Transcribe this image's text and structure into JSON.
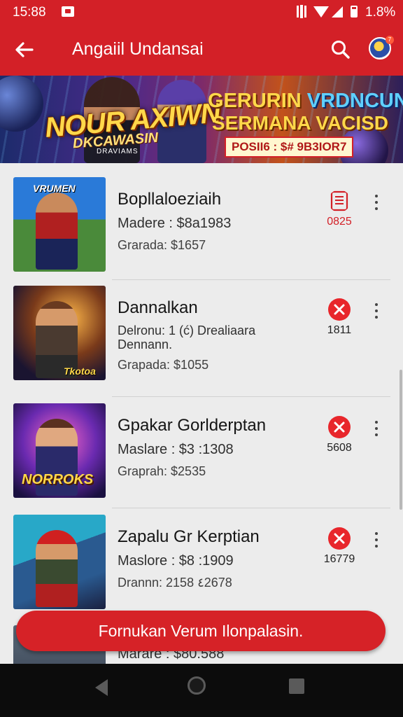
{
  "status_bar": {
    "time": "15:88",
    "battery": "1.8%"
  },
  "app_bar": {
    "title": "Angaiil Undansai",
    "avatar_badge": "7"
  },
  "banner": {
    "title": "NOUR AXIWN",
    "subtitle": "DKCAWASIN",
    "subtitle2": "DRAVIAMS",
    "headline1_a": "GERURIN",
    "headline1_b": "VRDNCUN",
    "headline2": "SERMANA VACISD",
    "promo_code": "POSII6 : $# 9B3IOR7"
  },
  "items": [
    {
      "name": "Bopllaloeziaih",
      "line2": "Madere : $8a1983",
      "line3": "Grarada: $1657",
      "action": "doc",
      "count": "0825",
      "thumb_tag": "VRUMEN"
    },
    {
      "name": "Dannalkan",
      "line2": "Delronu: 1 (ć) Drealiaara",
      "line2b": "Dennann.",
      "line3": "Grapada: $1055",
      "action": "close",
      "count": "1811",
      "thumb_tag": "Tkotoa"
    },
    {
      "name": "Gpakar Gorlderptan",
      "line2": "Maslare : $3 :1308",
      "line3": "Graprah: $2535",
      "action": "close",
      "count": "5608",
      "thumb_tag": "NORROKS"
    },
    {
      "name": "Zapalu Gr Kerptian",
      "line2": "Maslore : $8 :1909",
      "line3": "Drannn: 2158 ٤2678",
      "action": "close",
      "count": "16779",
      "thumb_tag": ""
    }
  ],
  "peek_item": {
    "line2": "Marare : $80.588"
  },
  "cta": {
    "label": "Fornukan Verum Ilonpalasin."
  },
  "colors": {
    "primary": "#d32027",
    "background": "#ececec"
  }
}
